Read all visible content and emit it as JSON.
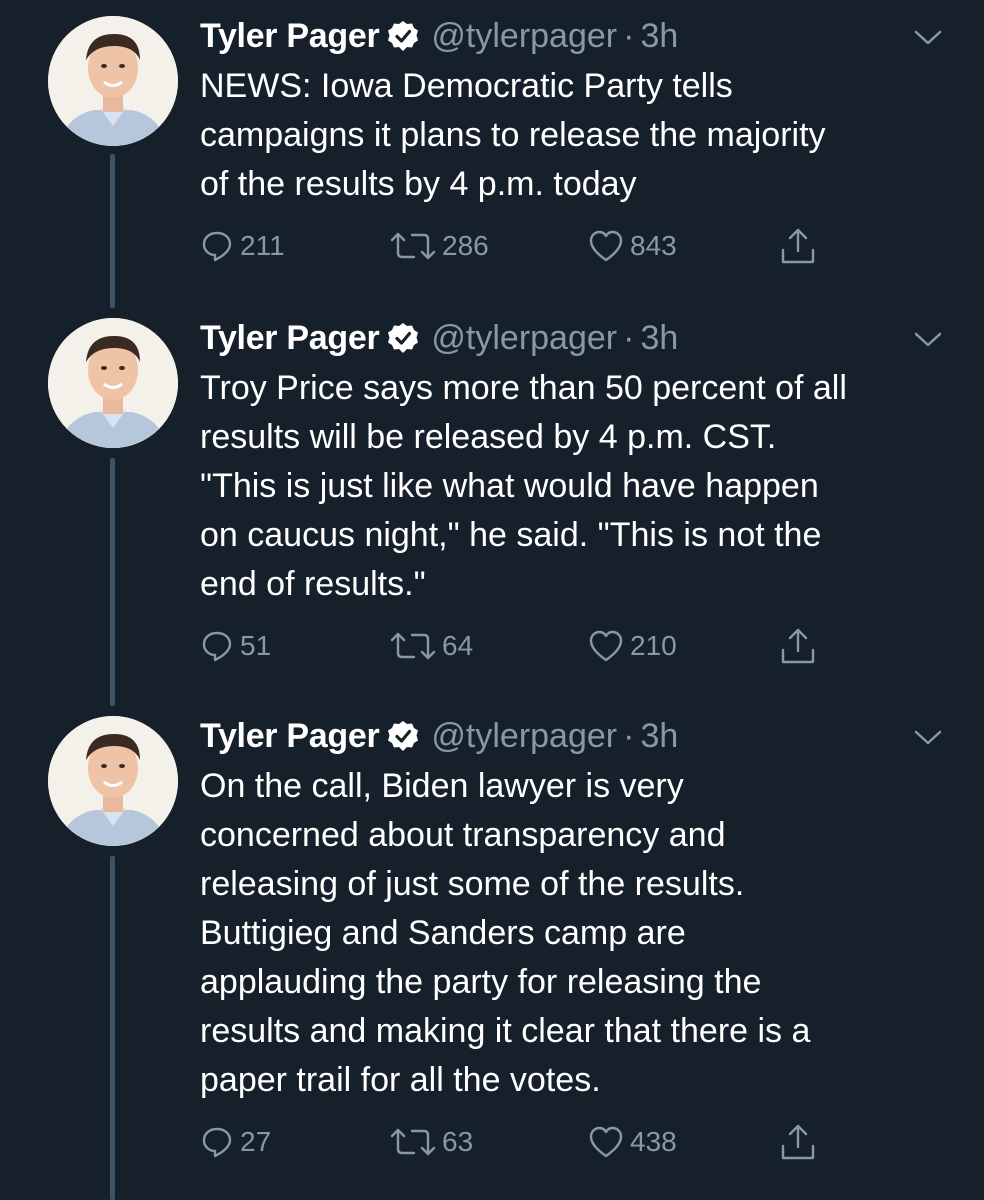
{
  "tweets": [
    {
      "name": "Tyler Pager",
      "handle": "@tylerpager",
      "separator": "·",
      "time": "3h",
      "lines": [
        "NEWS: Iowa Democratic Party tells",
        "campaigns it plans to release the majority",
        "of the results by 4 p.m. today"
      ],
      "replies": "211",
      "retweets": "286",
      "likes": "843"
    },
    {
      "name": "Tyler Pager",
      "handle": "@tylerpager",
      "separator": "·",
      "time": "3h",
      "lines": [
        "Troy Price says more than 50 percent of all",
        "results will be released by 4 p.m. CST.",
        "\"This is just like what would have happen",
        "on caucus night,\" he said. \"This is not the",
        "end of results.\""
      ],
      "replies": "51",
      "retweets": "64",
      "likes": "210"
    },
    {
      "name": "Tyler Pager",
      "handle": "@tylerpager",
      "separator": "·",
      "time": "3h",
      "lines": [
        "On the call, Biden lawyer is very",
        "concerned about transparency and",
        "releasing of just some of the results.",
        "Buttigieg and Sanders camp are",
        "applauding the party for releasing the",
        "results and making it clear that there is a",
        "paper trail for all the votes."
      ],
      "replies": "27",
      "retweets": "63",
      "likes": "438"
    }
  ],
  "colors": {
    "background": "#15202b",
    "text": "#ffffff",
    "muted": "#8899a6",
    "thread_line": "#3d5466"
  },
  "icons": {
    "verified": "verified-badge-icon",
    "more": "chevron-down-icon",
    "reply": "reply-icon",
    "retweet": "retweet-icon",
    "like": "heart-icon",
    "share": "share-icon"
  }
}
